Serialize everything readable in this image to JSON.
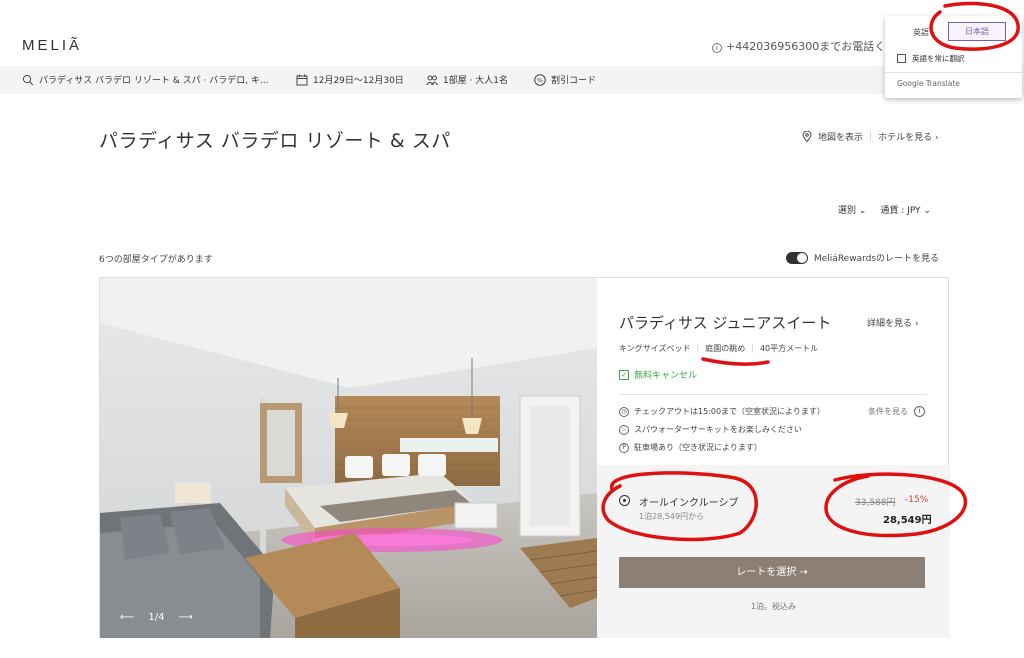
{
  "brand": {
    "logo": "MELIÃ"
  },
  "header": {
    "phone_text": "+442036956300までお電話くださ"
  },
  "search": {
    "destination": "パラディサス バラデロ リゾート & スパ · バラデロ, キ...",
    "dates": "12月29日〜12月30日",
    "guests": "1部屋 · 大人1名",
    "promo": "割引コード"
  },
  "translate_popup": {
    "tab_source": "英語",
    "tab_target": "日本語",
    "always_translate": "英語を常に翻訳",
    "brand": "Google Translate"
  },
  "hotel": {
    "title": "パラディサス バラデロ リゾート & スパ",
    "map_link": "地図を表示",
    "hotel_link": "ホテルを見る ›"
  },
  "filters": {
    "sort": "選別 ⌄",
    "currency": "通貨 : JPY ⌄"
  },
  "list": {
    "room_count": "6つの部屋タイプがあります",
    "rewards_label": "MeliáRewardsのレートを見る"
  },
  "room": {
    "name": "パラディサス ジュニアスイート",
    "details_link": "詳細を見る ›",
    "features": [
      "キングサイズベッド",
      "庭園の眺め",
      "40平方メートル"
    ],
    "free_cancel": "無料キャンセル",
    "checkout": "チェックアウトは15:00まで（空室状況によります）",
    "spa": "スパウォーターサーキットをお楽しみください",
    "parking": "駐車場あり（空き状況によります）",
    "conditions": "条件を見る",
    "gallery": "1/4"
  },
  "rate": {
    "name": "オールインクルーシブ",
    "per_night": "1泊28,549円から",
    "original_price": "33,588円",
    "discount": "-15%",
    "price": "28,549円",
    "select_button": "レートを選択 →",
    "tax_note": "1泊。税込み"
  },
  "colors": {
    "accent_button": "#8c7f75",
    "discount": "#d0443b",
    "free_cancel": "#3aa845",
    "translate_accent": "#7b5ea7",
    "annotation": "#e01010"
  }
}
